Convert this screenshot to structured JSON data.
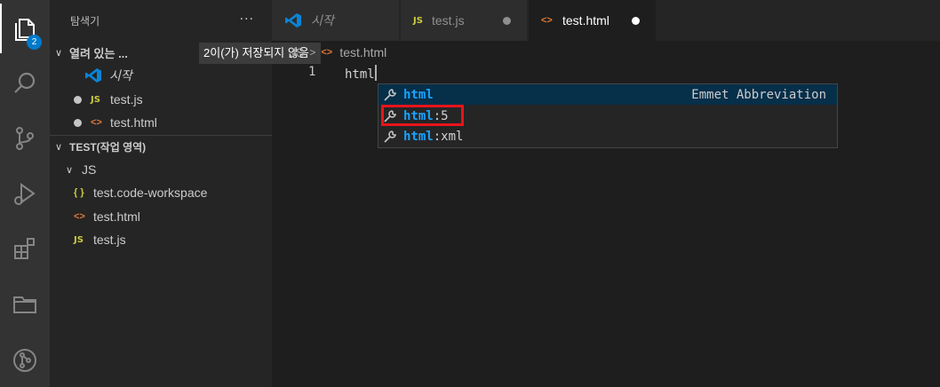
{
  "activity_bar": {
    "explorer_badge": "2",
    "icons": [
      "explorer-icon",
      "search-icon",
      "source-control-icon",
      "run-debug-icon",
      "extensions-icon",
      "folder-icon",
      "git-graph-icon"
    ]
  },
  "sidebar": {
    "title": "탐색기",
    "more": "···",
    "open_editors_label": "열려 있는 ...",
    "unsaved_tooltip": "2이(가) 저장되지 않음",
    "open_editors": [
      {
        "label": "시작",
        "icon": "vscode-icon"
      },
      {
        "label": "test.js",
        "icon": "js-icon"
      },
      {
        "label": "test.html",
        "icon": "html-icon"
      }
    ],
    "workspace_label": "TEST(작업 영역)",
    "folder": "JS",
    "files": [
      {
        "label": "test.code-workspace",
        "icon": "json-icon"
      },
      {
        "label": "test.html",
        "icon": "html-icon"
      },
      {
        "label": "test.js",
        "icon": "js-icon"
      }
    ]
  },
  "tabs": [
    {
      "label": "시작",
      "icon": "vscode-icon",
      "active": false
    },
    {
      "label": "test.js",
      "icon": "js-icon",
      "active": false
    },
    {
      "label": "test.html",
      "icon": "html-icon",
      "active": true
    }
  ],
  "breadcrumb": {
    "folder": "JS",
    "file": "test.html"
  },
  "editor": {
    "line_number": "1",
    "code": "html"
  },
  "suggest": {
    "items": [
      {
        "match": "html",
        "rest": "",
        "detail": "Emmet Abbreviation"
      },
      {
        "match": "html",
        "rest": ":5",
        "detail": ""
      },
      {
        "match": "html",
        "rest": ":xml",
        "detail": ""
      }
    ]
  },
  "colors": {
    "accent": "#007acc",
    "highlight_box": "#e8141b",
    "match_text": "#18a3ff",
    "js_icon": "#cbcb41",
    "html_icon": "#e37933"
  }
}
